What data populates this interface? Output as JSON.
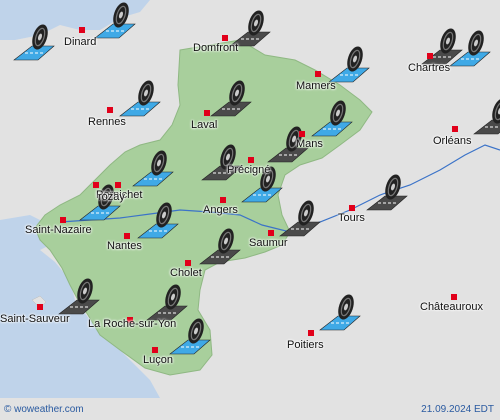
{
  "footer": {
    "copyright": "© woweather.com",
    "date": "21.09.2024 EDT"
  },
  "cities": [
    {
      "id": "dinard",
      "name": "Dinard"
    },
    {
      "id": "domfront",
      "name": "Domfront"
    },
    {
      "id": "chartres",
      "name": "Chartres"
    },
    {
      "id": "mamers",
      "name": "Mamers"
    },
    {
      "id": "rennes",
      "name": "Rennes"
    },
    {
      "id": "laval",
      "name": "Laval"
    },
    {
      "id": "mans",
      "name": "Mans"
    },
    {
      "id": "orleans",
      "name": "Orléans"
    },
    {
      "id": "precigne",
      "name": "Précigné"
    },
    {
      "id": "guerande",
      "name": "Pornichet"
    },
    {
      "id": "blain",
      "name": "rozay"
    },
    {
      "id": "angers",
      "name": "Angers"
    },
    {
      "id": "tours",
      "name": "Tours"
    },
    {
      "id": "saint-nazaire",
      "name": "Saint-Nazaire"
    },
    {
      "id": "nantes",
      "name": "Nantes"
    },
    {
      "id": "saumur",
      "name": "Saumur"
    },
    {
      "id": "cholet",
      "name": "Cholet"
    },
    {
      "id": "chateauroux",
      "name": "Châteauroux"
    },
    {
      "id": "saint-sauveur",
      "name": "Saint-Sauveur"
    },
    {
      "id": "la-roche",
      "name": "La Roche-sur-Yon"
    },
    {
      "id": "poitiers",
      "name": "Poitiers"
    },
    {
      "id": "lucon",
      "name": "Luçon"
    }
  ],
  "markers": [
    {
      "id": "m1",
      "icon": "road-tire-icon",
      "condition": "wet"
    },
    {
      "id": "m2",
      "icon": "road-tire-icon",
      "condition": "dry"
    },
    {
      "id": "m3",
      "icon": "road-tire-icon",
      "condition": "wet"
    },
    {
      "id": "m4",
      "icon": "road-tire-icon",
      "condition": "wet"
    },
    {
      "id": "m5",
      "icon": "road-tire-icon",
      "condition": "dry"
    },
    {
      "id": "m6",
      "icon": "road-tire-icon",
      "condition": "wet"
    },
    {
      "id": "m7",
      "icon": "road-tire-icon",
      "condition": "dry"
    },
    {
      "id": "m8",
      "icon": "road-tire-icon",
      "condition": "wet"
    },
    {
      "id": "m9",
      "icon": "road-tire-icon",
      "condition": "dry"
    },
    {
      "id": "m10",
      "icon": "road-tire-icon",
      "condition": "wet"
    },
    {
      "id": "m11",
      "icon": "road-tire-icon",
      "condition": "wet"
    },
    {
      "id": "m12",
      "icon": "road-tire-icon",
      "condition": "wet"
    },
    {
      "id": "m13",
      "icon": "road-tire-icon",
      "condition": "dry"
    },
    {
      "id": "m14",
      "icon": "road-tire-icon",
      "condition": "wet"
    },
    {
      "id": "m15",
      "icon": "road-tire-icon",
      "condition": "dry"
    },
    {
      "id": "m16",
      "icon": "road-tire-icon",
      "condition": "dry"
    },
    {
      "id": "m17",
      "icon": "road-tire-icon",
      "condition": "dry"
    },
    {
      "id": "m18",
      "icon": "road-tire-icon",
      "condition": "dry"
    },
    {
      "id": "m19",
      "icon": "road-tire-icon",
      "condition": "wet"
    },
    {
      "id": "m20",
      "icon": "road-tire-icon",
      "condition": "wet"
    },
    {
      "id": "m21",
      "icon": "road-tire-icon",
      "condition": "wet"
    },
    {
      "id": "m22",
      "icon": "road-tire-icon",
      "condition": "dry"
    },
    {
      "id": "m23",
      "icon": "road-tire-icon",
      "condition": "dry"
    }
  ],
  "colors": {
    "land": "#e2e2e2",
    "region": "#a8cf9c",
    "sea": "#bfd3ea",
    "river": "#3b73c8",
    "city_dot": "#e1001a",
    "wet_road": "#3fa9e6",
    "dry_road": "#4a4a4a"
  }
}
